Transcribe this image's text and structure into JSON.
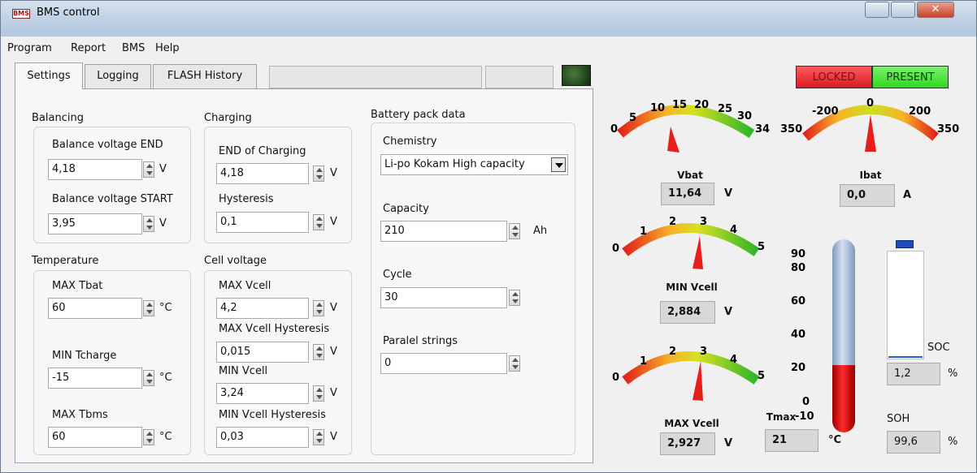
{
  "window": {
    "title": "BMS control",
    "icon_text": "BMS"
  },
  "menu": [
    "Program",
    "Report",
    "BMS",
    "Help"
  ],
  "tabs": [
    "Settings",
    "Logging",
    "FLASH History"
  ],
  "status": {
    "locked": "LOCKED",
    "present": "PRESENT",
    "locked_color": "#e8262c",
    "present_color": "#3ee32a"
  },
  "balancing": {
    "title": "Balancing",
    "end_label": "Balance voltage END",
    "end_value": "4,18",
    "end_unit": "V",
    "start_label": "Balance voltage START",
    "start_value": "3,95",
    "start_unit": "V"
  },
  "charging": {
    "title": "Charging",
    "end_label": "END of Charging",
    "end_value": "4,18",
    "end_unit": "V",
    "hyst_label": "Hysteresis",
    "hyst_value": "0,1",
    "hyst_unit": "V"
  },
  "temperature": {
    "title": "Temperature",
    "max_tbat_label": "MAX Tbat",
    "max_tbat_value": "60",
    "max_tbat_unit": "°C",
    "min_tcharge_label": "MIN Tcharge",
    "min_tcharge_value": "-15",
    "min_tcharge_unit": "°C",
    "max_tbms_label": "MAX Tbms",
    "max_tbms_value": "60",
    "max_tbms_unit": "°C"
  },
  "cell_voltage": {
    "title": "Cell voltage",
    "max_vcell_label": "MAX Vcell",
    "max_vcell_value": "4,2",
    "max_vcell_unit": "V",
    "max_hyst_label": "MAX Vcell Hysteresis",
    "max_hyst_value": "0,015",
    "max_hyst_unit": "V",
    "min_vcell_label": "MIN Vcell",
    "min_vcell_value": "3,24",
    "min_vcell_unit": "V",
    "min_hyst_label": "MIN Vcell Hysteresis",
    "min_hyst_value": "0,03",
    "min_hyst_unit": "V"
  },
  "battery_pack": {
    "title": "Battery pack data",
    "chemistry_label": "Chemistry",
    "chemistry_value": "Li-po Kokam High capacity",
    "capacity_label": "Capacity",
    "capacity_value": "210",
    "capacity_unit": "Ah",
    "cycle_label": "Cycle",
    "cycle_value": "30",
    "strings_label": "Paralel strings",
    "strings_value": "0"
  },
  "gauges": {
    "vbat": {
      "label": "Vbat",
      "value": "11,64",
      "unit": "V",
      "ticks": [
        "0",
        "5",
        "10",
        "15",
        "20",
        "25",
        "30",
        "34"
      ]
    },
    "ibat": {
      "label": "Ibat",
      "value": "0,0",
      "unit": "A",
      "ticks": [
        "350",
        "-200",
        "0",
        "200",
        "350"
      ]
    },
    "min_vcell": {
      "label": "MIN Vcell",
      "value": "2,884",
      "unit": "V",
      "ticks": [
        "0",
        "1",
        "2",
        "3",
        "4",
        "5"
      ]
    },
    "max_vcell": {
      "label": "MAX Vcell",
      "value": "2,927",
      "unit": "V",
      "ticks": [
        "0",
        "1",
        "2",
        "3",
        "4",
        "5"
      ]
    }
  },
  "thermometer": {
    "label": "Tmax",
    "value": "21",
    "unit": "°C",
    "ticks": [
      "90",
      "80",
      "60",
      "40",
      "20",
      "0",
      "-10"
    ],
    "level": 21
  },
  "soc": {
    "label": "SOC",
    "value": "1,2",
    "unit": "%",
    "level_percent": 1.2
  },
  "soh": {
    "label": "SOH",
    "value": "99,6",
    "unit": "%"
  }
}
